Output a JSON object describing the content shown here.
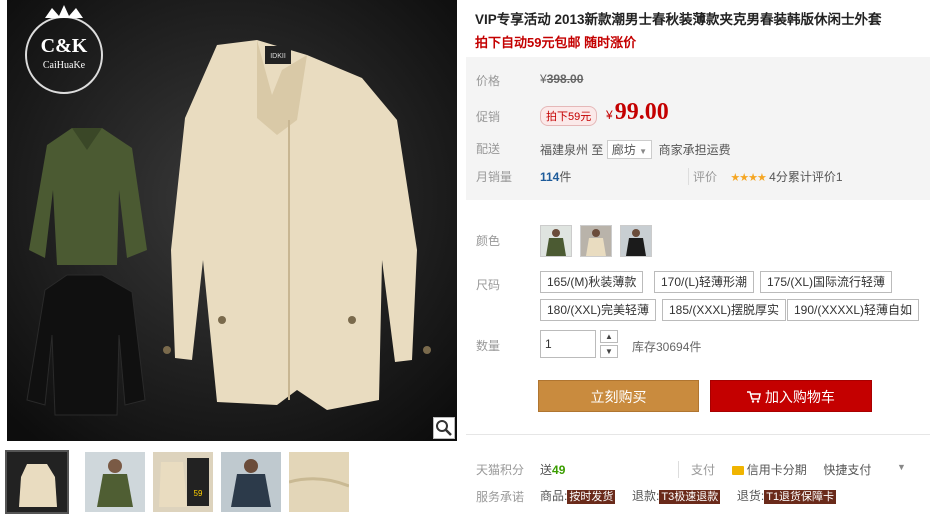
{
  "gallery": {
    "logo_text": "C&K",
    "logo_sub": "CaiHuaKe",
    "collar_tag": "IDKII",
    "thumb_count": 5
  },
  "product": {
    "title": "VIP专享活动 2013新款潮男士春秋装薄款夹克男春装韩版休闲士外套",
    "subtitle": "拍下自动59元包邮 随时涨价"
  },
  "price": {
    "label": "价格",
    "currency": "¥",
    "original": "398.00",
    "promo_label": "促销",
    "promo_tag": "拍下59元",
    "current": "99.00"
  },
  "shipping": {
    "label": "配送",
    "from": "福建泉州",
    "to_word": "至",
    "to_city": "廊坊",
    "fee_text": "商家承担运费"
  },
  "sales": {
    "label": "月销量",
    "count": "114",
    "unit": "件",
    "rating_label": "评价",
    "stars": "★★★★",
    "rating_text": "4分累计评价1"
  },
  "color": {
    "label": "颜色"
  },
  "size": {
    "label": "尺码",
    "options": [
      "165/(M)秋装薄款",
      "170/(L)轻薄形潮",
      "175/(XL)国际流行轻薄",
      "180/(XXL)完美轻薄",
      "185/(XXXL)摆脱厚实",
      "190/(XXXXL)轻薄自如"
    ]
  },
  "quantity": {
    "label": "数量",
    "value": "1",
    "stock": "库存30694件"
  },
  "buttons": {
    "buy": "立刻购买",
    "cart": "加入购物车"
  },
  "points": {
    "label": "天猫积分",
    "send": "送",
    "amount": "49"
  },
  "payment": {
    "label": "支付",
    "credit": "信用卡分期",
    "quick": "快捷支付"
  },
  "service": {
    "label": "服务承诺",
    "goods_label": "商品:",
    "goods_badge": "按时发货",
    "refund_label": "退款:",
    "refund_badge": "T3极速退款",
    "return_label": "退货:",
    "return_badge": "T1退货保障卡"
  },
  "colors": {
    "price_red": "#c40000",
    "buy_orange": "#c98b3e",
    "points_green": "#3a9d00"
  }
}
